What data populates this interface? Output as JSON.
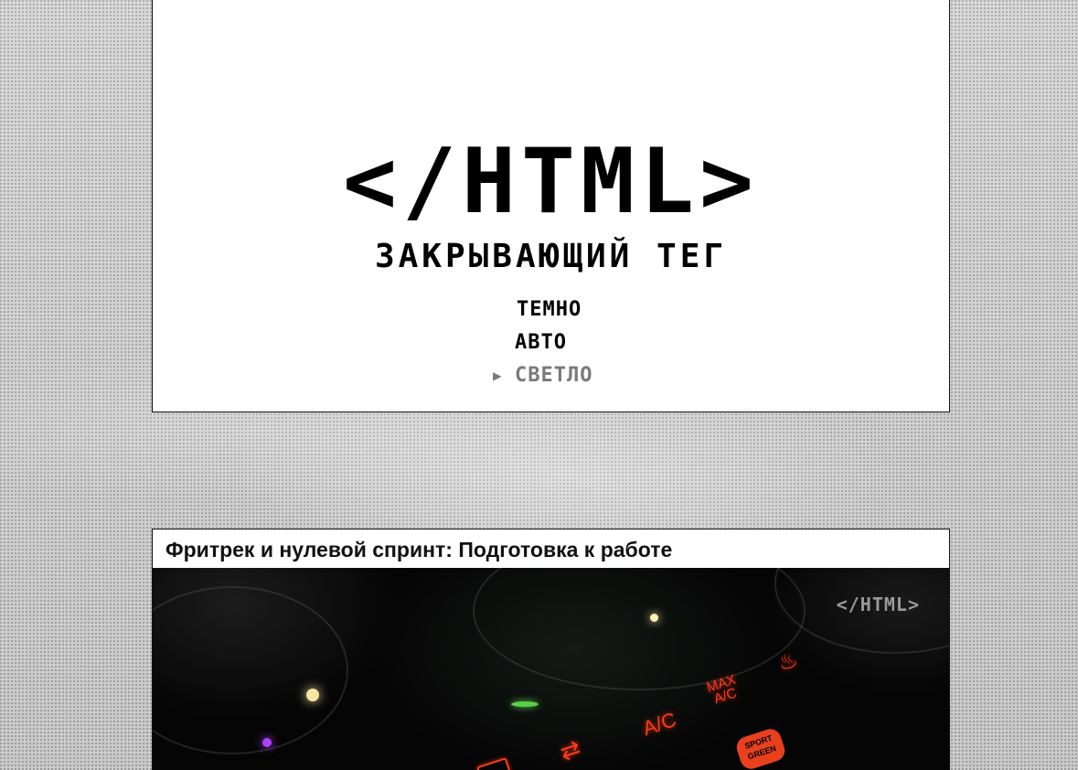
{
  "site": {
    "logo_text": "</HTML>",
    "subtitle": "ЗАКРЫВАЮЩИЙ ТЕГ"
  },
  "theme_switcher": {
    "options": [
      {
        "label": "ТЕМНО",
        "selected": false
      },
      {
        "label": "АВТО",
        "selected": false
      },
      {
        "label": "СВЕТЛО",
        "selected": true
      }
    ],
    "pointer_glyph": "▶"
  },
  "article": {
    "title": "Фритрек и нулевой спринт: Подготовка к работе",
    "image": {
      "watermark": "</HTML>",
      "buttons": {
        "ac": "A/C",
        "max_ac_line1": "MAX",
        "max_ac_line2": "A/C",
        "sport_line1": "SPORT",
        "sport_line2": "GREEN",
        "recirc_icon": "car-recirculation-icon",
        "seat_icon": "heated-seat-icon"
      }
    }
  },
  "colors": {
    "page_bg": "#d4d4d4",
    "card_bg": "#ffffff",
    "selected_theme": "#7a7a7a",
    "dash_light": "#ff3a1a"
  }
}
